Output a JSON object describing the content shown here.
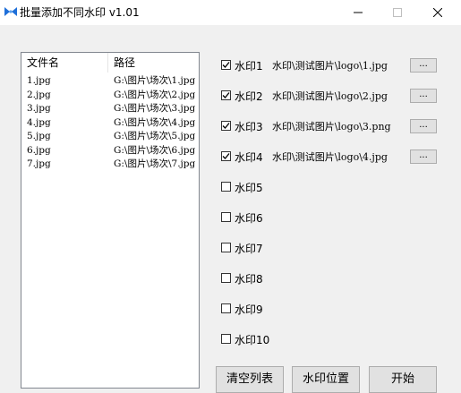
{
  "window": {
    "title": "批量添加不同水印 v1.01",
    "minimize_glyph": "—",
    "close_glyph": "✕"
  },
  "file_list": {
    "columns": [
      "文件名",
      "路径"
    ],
    "rows": [
      {
        "name": "1.jpg",
        "path": "G:\\图片\\场次\\1.jpg"
      },
      {
        "name": "2.jpg",
        "path": "G:\\图片\\场次\\2.jpg"
      },
      {
        "name": "3.jpg",
        "path": "G:\\图片\\场次\\3.jpg"
      },
      {
        "name": "4.jpg",
        "path": "G:\\图片\\场次\\4.jpg"
      },
      {
        "name": "5.jpg",
        "path": "G:\\图片\\场次\\5.jpg"
      },
      {
        "name": "6.jpg",
        "path": "G:\\图片\\场次\\6.jpg"
      },
      {
        "name": "7.jpg",
        "path": "G:\\图片\\场次\\7.jpg"
      }
    ]
  },
  "watermarks": [
    {
      "label": "水印1",
      "checked": true,
      "path": "水印\\测试图片\\logo\\1.jpg",
      "browse": "..."
    },
    {
      "label": "水印2",
      "checked": true,
      "path": "水印\\测试图片\\logo\\2.jpg",
      "browse": "..."
    },
    {
      "label": "水印3",
      "checked": true,
      "path": "水印\\测试图片\\logo\\3.png",
      "browse": "..."
    },
    {
      "label": "水印4",
      "checked": true,
      "path": "水印\\测试图片\\logo\\4.jpg",
      "browse": "..."
    },
    {
      "label": "水印5",
      "checked": false
    },
    {
      "label": "水印6",
      "checked": false
    },
    {
      "label": "水印7",
      "checked": false
    },
    {
      "label": "水印8",
      "checked": false
    },
    {
      "label": "水印9",
      "checked": false
    },
    {
      "label": "水印10",
      "checked": false
    }
  ],
  "actions": {
    "clear_list": "清空列表",
    "watermark_position": "水印位置",
    "start": "开始"
  },
  "colors": {
    "window_bg": "#f0f0f0",
    "titlebar_bg": "#ffffff",
    "button_bg": "#e1e1e1",
    "button_border": "#adadad",
    "icon_blue": "#1e6fd9"
  }
}
